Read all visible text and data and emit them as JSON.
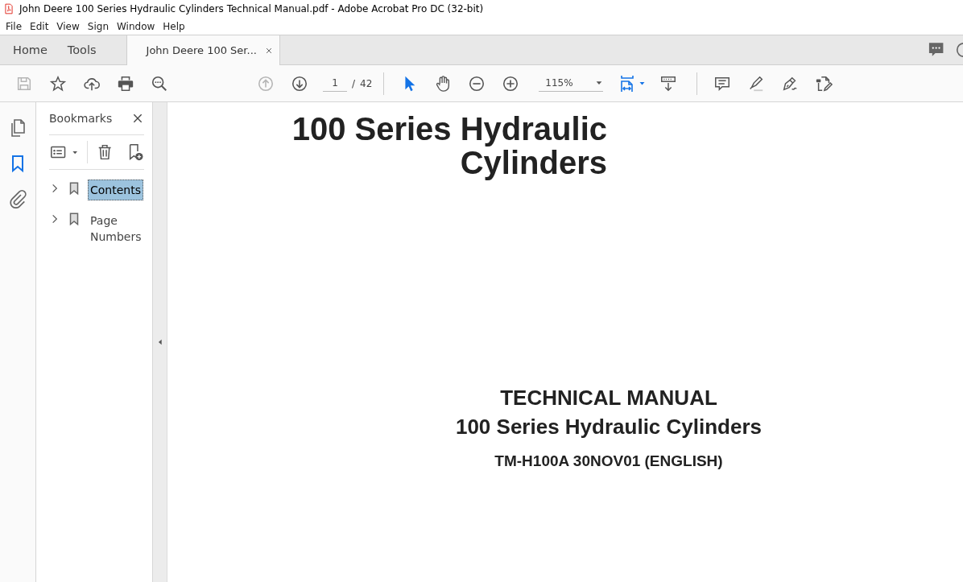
{
  "window": {
    "title": "John Deere 100 Series Hydraulic Cylinders Technical Manual.pdf - Adobe Acrobat Pro DC (32-bit)"
  },
  "menu": [
    "File",
    "Edit",
    "View",
    "Sign",
    "Window",
    "Help"
  ],
  "tabs": [
    {
      "label": "Home",
      "selected": false,
      "kind": "nav"
    },
    {
      "label": "Tools",
      "selected": false,
      "kind": "nav"
    },
    {
      "label": "John Deere 100 Ser...",
      "selected": true,
      "kind": "document"
    }
  ],
  "toolbar": {
    "left": [
      {
        "kind": "save",
        "disabled": true
      },
      {
        "kind": "star",
        "disabled": false
      },
      {
        "kind": "upload",
        "disabled": false
      },
      {
        "kind": "print",
        "disabled": false
      },
      {
        "kind": "find",
        "disabled": false
      }
    ],
    "nav": [
      {
        "kind": "prev",
        "disabled": true
      },
      {
        "kind": "next",
        "disabled": false
      }
    ],
    "page": "1",
    "separator": "/",
    "page_total": "42",
    "tools": [
      {
        "kind": "select",
        "selected": true
      },
      {
        "kind": "hand",
        "selected": false
      }
    ],
    "zoom": "115%",
    "right": [
      {
        "kind": "comment"
      },
      {
        "kind": "highlight"
      },
      {
        "kind": "sign"
      },
      {
        "kind": "edit"
      }
    ]
  },
  "rail": [
    {
      "kind": "pages",
      "selected": false
    },
    {
      "kind": "bookmarks",
      "selected": true
    },
    {
      "kind": "attachments",
      "selected": false
    }
  ],
  "bookmarks": {
    "title": "Bookmarks",
    "items": [
      {
        "label": "Contents",
        "selected": true,
        "expanded": false
      },
      {
        "label": "Page Numbers",
        "selected": false,
        "expanded": false
      }
    ]
  },
  "document": {
    "title_lines": [
      "100 Series Hydraulic",
      "Cylinders"
    ],
    "heading": "TECHNICAL MANUAL",
    "subheading": "100 Series Hydraulic Cylinders",
    "code": "TM-H100A 30NOV01 (ENGLISH)"
  }
}
